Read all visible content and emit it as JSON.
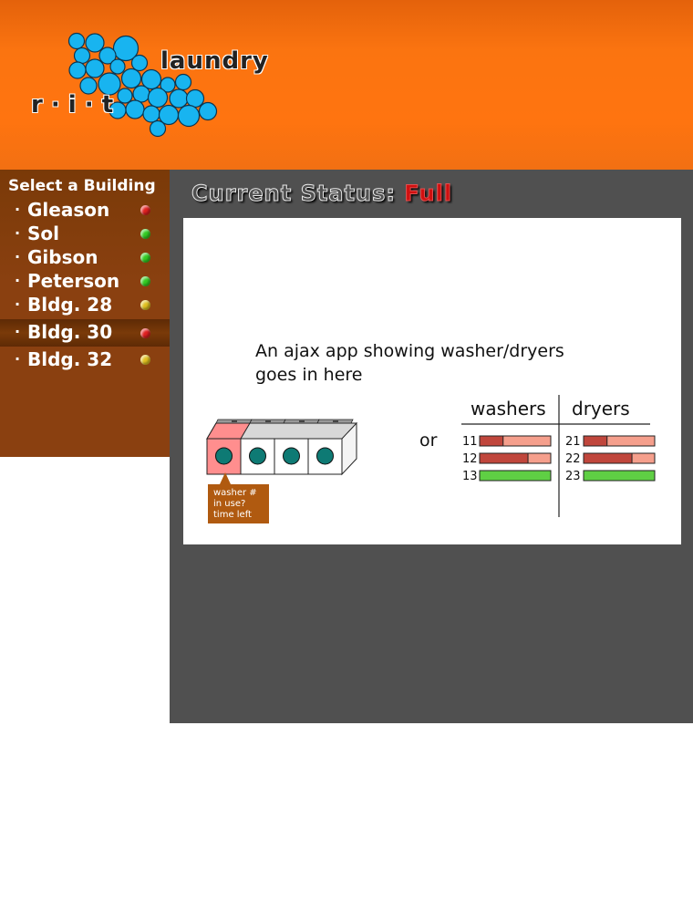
{
  "header": {
    "logo_word": "laundry",
    "logo_rit": "r · i · t"
  },
  "sidebar": {
    "title": "Select a Building",
    "bullet": "·",
    "items": [
      {
        "label": "Gleason",
        "status_color": "#e02020"
      },
      {
        "label": "Sol",
        "status_color": "#33cc22"
      },
      {
        "label": "Gibson",
        "status_color": "#33cc22"
      },
      {
        "label": "Peterson",
        "status_color": "#33cc22"
      },
      {
        "label": "Bldg. 28",
        "status_color": "#e0c020"
      },
      {
        "label": "Bldg. 30",
        "status_color": "#e02020",
        "active": true
      },
      {
        "label": "Bldg. 32",
        "status_color": "#e0c020"
      }
    ]
  },
  "main": {
    "status_label": "Current Status:",
    "status_value": "Full",
    "status_color": "#d01010",
    "placeholder_line1": "An ajax app showing washer/dryers",
    "placeholder_line2": "goes in here",
    "or": "or",
    "tooltip": {
      "line1": "washer #",
      "line2": "in use?",
      "line3": "time left"
    },
    "table": {
      "washers_header": "washers",
      "dryers_header": "dryers",
      "washers": [
        {
          "num": "11",
          "used": 0.33
        },
        {
          "num": "12",
          "used": 0.68
        },
        {
          "num": "13",
          "used": 0
        }
      ],
      "dryers": [
        {
          "num": "21",
          "used": 0.33
        },
        {
          "num": "22",
          "used": 0.68
        },
        {
          "num": "23",
          "used": 0
        }
      ]
    }
  },
  "colors": {
    "header_orange": "#ff7410",
    "sidebar_brown": "#8a4010",
    "main_gray": "#505050",
    "bubble_blue": "#18b4f0",
    "in_use_dark": "#c0463c",
    "in_use_light": "#f59f8c",
    "free_green": "#5fcf44",
    "washer_drum": "#0e7a74",
    "active_washer": "#ff8e8e"
  }
}
